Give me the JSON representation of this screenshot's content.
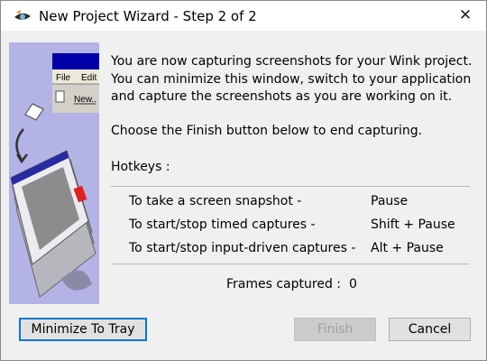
{
  "window": {
    "title": "New Project Wizard - Step 2 of 2",
    "close_symbol": "✕"
  },
  "side_image": {
    "menu_file": "File",
    "menu_edit": "Edit",
    "new_item": "New.."
  },
  "content": {
    "intro": "You are now capturing screenshots for your Wink project. You can minimize this window, switch to your application and capture the screenshots as you are working on it.",
    "finish_note": "Choose the Finish button below to end capturing.",
    "hotkeys_label": "Hotkeys :",
    "hotkeys": [
      {
        "action": "To take a screen snapshot -",
        "key": "Pause"
      },
      {
        "action": "To start/stop timed captures -",
        "key": "Shift + Pause"
      },
      {
        "action": "To start/stop input-driven captures -",
        "key": "Alt + Pause"
      }
    ],
    "frames_label": "Frames captured :",
    "frames_value": "0"
  },
  "buttons": {
    "minimize": "Minimize To Tray",
    "finish": "Finish",
    "cancel": "Cancel"
  },
  "colors": {
    "sidebar_bg": "#b3b3e6",
    "focus_border": "#0078d7",
    "rule": "#b9b9b9"
  }
}
